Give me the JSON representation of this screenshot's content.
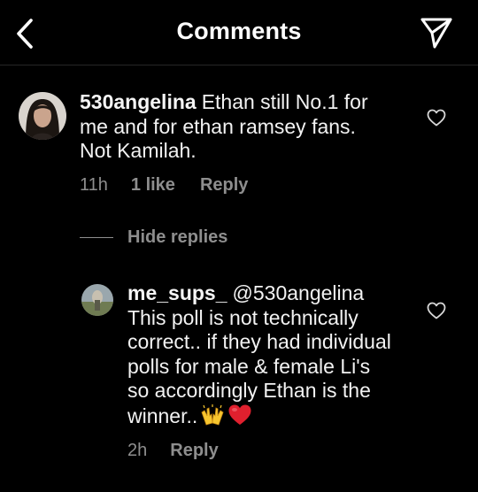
{
  "header": {
    "title": "Comments",
    "back_icon": "chevron-left-icon",
    "share_icon": "paper-plane-icon"
  },
  "comments": [
    {
      "username": "530angelina",
      "text": "Ethan still No.1 for me and for ethan ramsey fans. Not Kamilah.",
      "time": "11h",
      "likes": "1 like",
      "reply_label": "Reply"
    }
  ],
  "hide_replies_label": "Hide replies",
  "replies": [
    {
      "username": "me_sups_",
      "mention": "@530angelina",
      "text": "This poll is not technically correct.. if they had individual polls for male & female Li's so accordingly Ethan is the winner..",
      "emojis": [
        "raising-hands-emoji",
        "red-heart-emoji"
      ],
      "time": "2h",
      "reply_label": "Reply"
    }
  ],
  "colors": {
    "background": "#000000",
    "text": "#f2f2f2",
    "secondary_text": "#8e8e8e",
    "heart_emoji": "#e0202e",
    "hands_emoji": "#f7c62f"
  }
}
